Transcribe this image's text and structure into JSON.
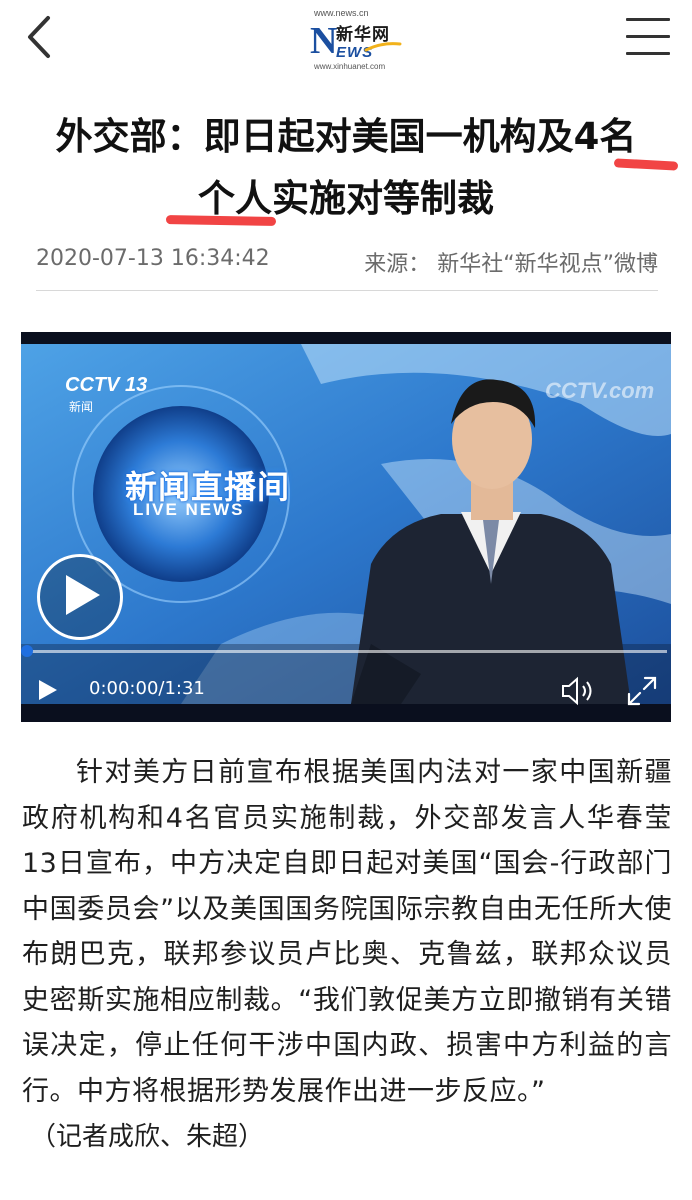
{
  "header": {
    "logo_url_top": "www.news.cn",
    "logo_cn": "新华网",
    "logo_en_n": "N",
    "logo_en_rest": "EWS",
    "logo_url_bottom": "www.xinhuanet.com"
  },
  "article": {
    "title_line1_a": "外交部：即日起对美国一机构及",
    "title_line1_b": "4名",
    "title_line2_a": "个人",
    "title_line2_b": "实施对等制裁",
    "date": "2020-07-13 16:34:42",
    "source": "来源： 新华社“新华视点”微博",
    "body": "针对美方日前宣布根据美国内法对一家中国新疆政府机构和4名官员实施制裁，外交部发言人华春莹13日宣布，中方决定自即日起对美国“国会-行政部门中国委员会”以及美国国务院国际宗教自由无任所大使布朗巴克，联邦参议员卢比奥、克鲁兹，联邦众议员史密斯实施相应制裁。“我们敦促美方立即撤销有关错误决定，停止任何干涉中国内政、损害中方利益的言行。中方将根据形势发展作出进一步反应。”",
    "reporter": "（记者成欣、朱超）"
  },
  "video": {
    "channel_logo": "CCTV 13",
    "channel_sub": "新闻",
    "watermark": "CCTV.com",
    "program_cn": "新闻直播间",
    "program_en": "LIVE NEWS",
    "time": "0:00:00/1:31",
    "progress": 0.0
  },
  "colors": {
    "highlight_mark": "#f03a3a",
    "video_blue": "#2f7fd4",
    "progress_knob": "#1f6fe0"
  }
}
